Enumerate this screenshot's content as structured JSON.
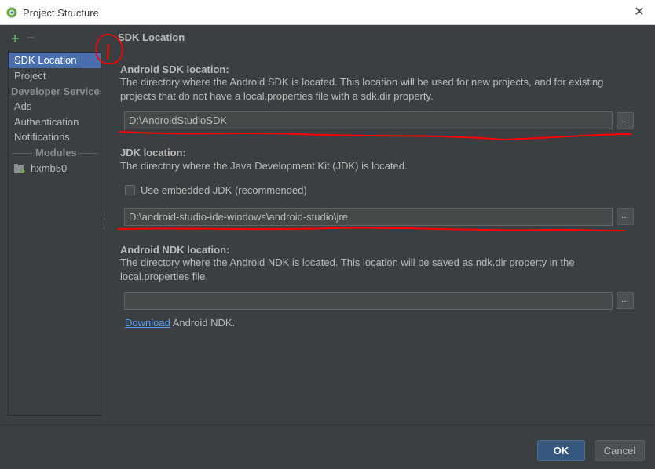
{
  "window": {
    "title": "Project Structure",
    "close_glyph": "✕",
    "app_icon": "android-studio-icon"
  },
  "sidebar": {
    "add_glyph": "+",
    "remove_glyph": "−",
    "items": [
      {
        "label": "SDK Location",
        "selected": true
      },
      {
        "label": "Project"
      },
      {
        "header": "Developer Services"
      },
      {
        "label": "Ads"
      },
      {
        "label": "Authentication"
      },
      {
        "label": "Notifications"
      }
    ],
    "modules_header": "Modules",
    "modules": [
      {
        "label": "hxmb50",
        "icon": "module-folder-icon"
      }
    ]
  },
  "main": {
    "section_title": "SDK Location",
    "android_sdk": {
      "label": "Android SDK location:",
      "description": "The directory where the Android SDK is located. This location will be used for new projects, and for existing projects that do not have a local.properties file with a sdk.dir property.",
      "path": "D:\\AndroidStudioSDK",
      "browse_glyph": "..."
    },
    "jdk": {
      "label": "JDK location:",
      "description": "The directory where the Java Development Kit (JDK) is located.",
      "embedded_label": "Use embedded JDK (recommended)",
      "embedded_checked": false,
      "path": "D:\\android-studio-ide-windows\\android-studio\\jre",
      "browse_glyph": "..."
    },
    "ndk": {
      "label": "Android NDK location:",
      "description": "The directory where the Android NDK is located. This location will be saved as ndk.dir property in the local.properties file.",
      "path": "",
      "browse_glyph": "...",
      "download_link": "Download",
      "download_suffix": " Android NDK."
    }
  },
  "buttons": {
    "ok": "OK",
    "cancel": "Cancel"
  },
  "colors": {
    "background": "#3c3f41",
    "selection": "#4b6eaf",
    "link": "#589df6",
    "annotation": "#ff0000",
    "add_icon": "#59a869"
  }
}
